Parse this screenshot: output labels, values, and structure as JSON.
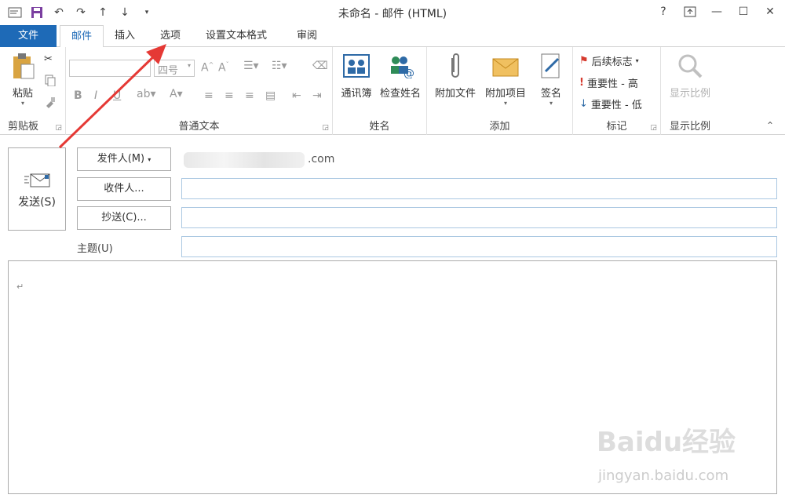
{
  "window": {
    "title": "未命名 - 邮件 (HTML)",
    "help": "?",
    "controls": [
      "ribbon-display",
      "minimize",
      "maximize",
      "close"
    ]
  },
  "quick_access": [
    "save-icon",
    "undo-icon",
    "redo-icon",
    "up-icon",
    "down-icon",
    "customize-icon"
  ],
  "tabs": [
    {
      "label": "文件"
    },
    {
      "label": "邮件"
    },
    {
      "label": "插入"
    },
    {
      "label": "选项"
    },
    {
      "label": "设置文本格式"
    },
    {
      "label": "审阅"
    }
  ],
  "ribbon": {
    "clipboard": {
      "label": "剪贴板",
      "paste": "粘贴"
    },
    "basic_text": {
      "label": "普通文本",
      "font_size": "四号"
    },
    "names": {
      "label": "姓名",
      "address_book": "通讯簿",
      "check_names": "检查姓名"
    },
    "include": {
      "label": "添加",
      "attach_file": "附加文件",
      "attach_item": "附加项目",
      "signature": "签名"
    },
    "tags": {
      "label": "标记",
      "follow_up": "后续标志",
      "high": "重要性 - 高",
      "low": "重要性 - 低"
    },
    "zoom": {
      "label": "显示比例",
      "zoom": "显示比例"
    }
  },
  "compose": {
    "send": "发送(S)",
    "from_button": "发件人(M)",
    "from_value_visible": ".com",
    "to_button": "收件人...",
    "cc_button": "抄送(C)...",
    "subject_label": "主题(U)",
    "to_value": "",
    "cc_value": "",
    "subject_value": "",
    "paragraph_mark": "↵"
  },
  "watermark": {
    "text": "Baidu经验",
    "sub": "jingyan.baidu.com"
  },
  "colors": {
    "accent": "#1e6ab7",
    "arrow": "#e53935"
  }
}
